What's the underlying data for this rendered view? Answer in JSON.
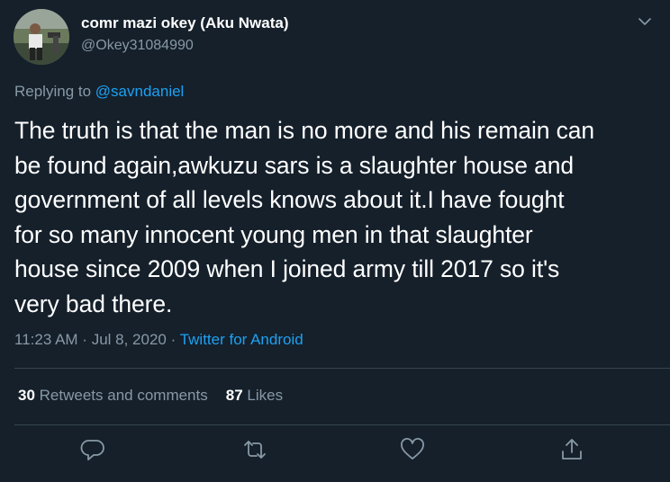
{
  "author": {
    "display_name": "comr mazi okey (Aku Nwata)",
    "handle": "@Okey31084990",
    "avatar_icon": "user-avatar-photo"
  },
  "reply": {
    "prefix": "Replying to",
    "to": "@savndaniel"
  },
  "tweet": {
    "lines": [
      "The truth is that the man is no more and his remain can",
      "be found again,awkuzu sars is a slaughter house and",
      "government of all levels knows about it.I have fought",
      "for so many innocent young men in that slaughter",
      "house since 2009 when I joined army till 2017 so it's",
      "very bad there."
    ],
    "time": "11:23 AM",
    "sep1": " · ",
    "date": "Jul 8, 2020",
    "sep2": " · ",
    "source": "Twitter for Android"
  },
  "stats": {
    "retweets_count": "30",
    "retweets_label": "Retweets and comments",
    "likes_count": "87",
    "likes_label": "Likes"
  },
  "colors": {
    "background": "#15202b",
    "secondary_text": "#8899a6",
    "link": "#1da1f2",
    "divider": "#38444d"
  },
  "icons": [
    "chevron-down-icon",
    "reply-icon",
    "retweet-icon",
    "like-icon",
    "share-icon"
  ]
}
